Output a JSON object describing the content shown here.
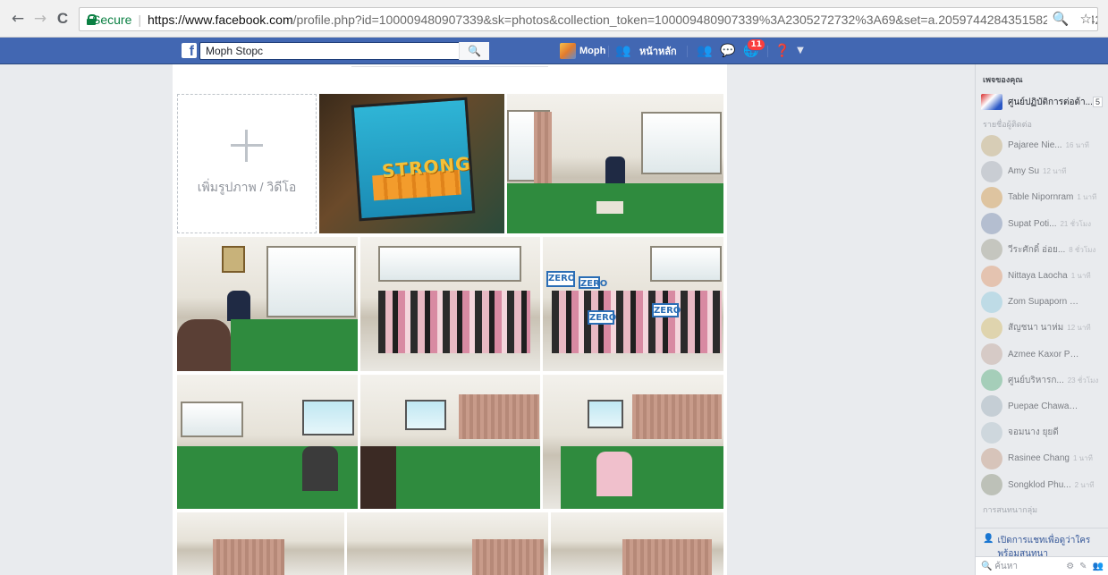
{
  "browser": {
    "back": "←",
    "forward": "→",
    "reload": "C",
    "secure_label": "Secure",
    "url_host": "https://www.facebook.com",
    "url_rest": "/profile.php?id=100009480907339&sk=photos&collection_token=100009480907339%3A2305272732%3A69&set=a.2059744284351582.1073742040...",
    "zoom_icon": "🔍",
    "star_icon": "☆"
  },
  "fb": {
    "logo": "f",
    "search_value": "Moph Stopc",
    "search_icon": "🔍",
    "profile_name": "Moph",
    "home_label": "หน้าหลัก",
    "notifications_badge": "11",
    "accent": "#4267b2"
  },
  "album": {
    "add_label": "เพิ่มรูปภาพ / วิดีโอ"
  },
  "sidebar": {
    "pages_header": "เพจของคุณ",
    "page_name": "ศูนย์ปฏิบัติการต่อต้า...",
    "page_count": "5",
    "contacts_header": "รายชื่อผู้ติดต่อ",
    "contacts": [
      {
        "name": "Pajaree Nie...",
        "time": "16 นาที",
        "color": "#c9b68a"
      },
      {
        "name": "Amy Su",
        "time": "12 นาที",
        "color": "#b0b5bd"
      },
      {
        "name": "Table Nipornram",
        "time": "1 นาที",
        "color": "#d6a561"
      },
      {
        "name": "Supat Poti...",
        "time": "21 ชั่วโมง",
        "color": "#8a9bb8"
      },
      {
        "name": "วีระศักดิ์ อ่อย...",
        "time": "8 ชั่วโมง",
        "color": "#a8a89a"
      },
      {
        "name": "Nittaya Laocha",
        "time": "1 นาที",
        "color": "#e0a37e"
      },
      {
        "name": "Zom Supaporn Boo...",
        "time": "",
        "color": "#9ccfe0"
      },
      {
        "name": "สัญชนา นาห่ม",
        "time": "12 นาที",
        "color": "#d8c27a"
      },
      {
        "name": "Azmee Kaxor Phos",
        "time": "",
        "color": "#c7b0a6"
      },
      {
        "name": "ศูนย์บริหารก...",
        "time": "23 ชั่วโมง",
        "color": "#6fb88f"
      },
      {
        "name": "Puepae Chawantha...",
        "time": "",
        "color": "#a9b8c2"
      },
      {
        "name": "จอมนาง ยุยดี",
        "time": "",
        "color": "#b8c8d0"
      },
      {
        "name": "Rasinee Chang",
        "time": "1 นาที",
        "color": "#c9a590"
      },
      {
        "name": "Songklod Phu...",
        "time": "2 นาที",
        "color": "#9aa08c"
      }
    ],
    "group_header": "การสนทนากลุ่ม",
    "open_chat": "เปิดการแชทเพื่อดูว่าใคร พร้อมสนทนา",
    "search_placeholder": "ค้นหา"
  }
}
